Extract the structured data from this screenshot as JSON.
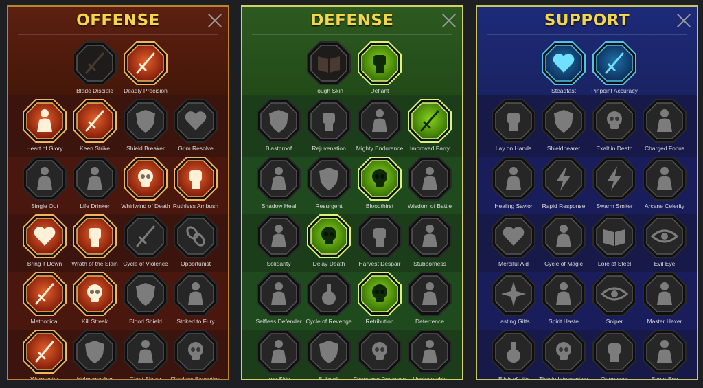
{
  "panels": [
    {
      "key": "offense",
      "title": "OFFENSE",
      "colors": {
        "active_fill": "#e2602a",
        "active_fill_dark": "#7a1708",
        "active_ring": "#f3b45a",
        "glyph": "#fff0d8"
      },
      "skills": [
        {
          "label": "Blade Disciple",
          "active": false,
          "dim": true,
          "icon": "crossed-swords-icon"
        },
        {
          "label": "Deadly Precision",
          "active": true,
          "icon": "slashing-blade-icon"
        },
        {
          "label": "Heart of Glory",
          "active": true,
          "icon": "horned-figure-icon"
        },
        {
          "label": "Keen Strike",
          "active": true,
          "icon": "arrow-strike-icon"
        },
        {
          "label": "Shield Breaker",
          "active": false,
          "icon": "broken-shield-icon"
        },
        {
          "label": "Grim Resolve",
          "active": false,
          "icon": "pierced-heart-icon"
        },
        {
          "label": "Single Out",
          "active": false,
          "icon": "single-out-icon"
        },
        {
          "label": "Life Drinker",
          "active": false,
          "icon": "fanged-mask-icon"
        },
        {
          "label": "Whirlwind of Death",
          "active": true,
          "icon": "skull-whirlwind-icon"
        },
        {
          "label": "Ruthless Ambush",
          "active": true,
          "icon": "dagger-hand-icon"
        },
        {
          "label": "Bring it Down",
          "active": true,
          "icon": "sword-heart-icon"
        },
        {
          "label": "Wrath of the Slain",
          "active": true,
          "icon": "fist-sword-icon"
        },
        {
          "label": "Cycle of Violence",
          "active": false,
          "icon": "axe-icon"
        },
        {
          "label": "Opportunist",
          "active": false,
          "icon": "chains-icon"
        },
        {
          "label": "Methodical",
          "active": true,
          "icon": "arrows-target-icon"
        },
        {
          "label": "Kill Streak",
          "active": true,
          "icon": "double-skull-icon"
        },
        {
          "label": "Blood Shield",
          "active": false,
          "icon": "blood-shield-icon"
        },
        {
          "label": "Stoked to Fury",
          "active": false,
          "icon": "raging-figure-icon"
        },
        {
          "label": "Warmaster",
          "active": true,
          "icon": "hammer-strike-icon"
        },
        {
          "label": "Helmsmasher",
          "active": false,
          "icon": "helm-icon"
        },
        {
          "label": "Giant Slayer",
          "active": false,
          "icon": "giant-icon"
        },
        {
          "label": "Flawless Execution",
          "active": false,
          "icon": "execution-skull-icon"
        }
      ]
    },
    {
      "key": "defense",
      "title": "DEFENSE",
      "colors": {
        "active_fill": "#8ad21a",
        "active_fill_dark": "#2f6a05",
        "active_ring": "#d8f57a",
        "glyph": "#0f2a06"
      },
      "skills": [
        {
          "label": "Tough Skin",
          "active": false,
          "dim": true,
          "icon": "scales-icon"
        },
        {
          "label": "Defiant",
          "active": true,
          "icon": "raised-fist-icon"
        },
        {
          "label": "Blastproof",
          "active": false,
          "icon": "chevron-shield-icon"
        },
        {
          "label": "Rejuvenation",
          "active": false,
          "icon": "hand-icon"
        },
        {
          "label": "Mighty Endurance",
          "active": false,
          "icon": "muscle-figure-icon"
        },
        {
          "label": "Improved Parry",
          "active": true,
          "icon": "crossed-blades-icon"
        },
        {
          "label": "Shadow Heal",
          "active": false,
          "icon": "shadow-figure-icon"
        },
        {
          "label": "Resurgent",
          "active": false,
          "icon": "knight-shield-icon"
        },
        {
          "label": "Bloodthirst",
          "active": true,
          "icon": "skull-heart-icon"
        },
        {
          "label": "Wisdom of Battle",
          "active": false,
          "icon": "hooded-figure-icon"
        },
        {
          "label": "Solidarity",
          "active": false,
          "icon": "group-figures-icon"
        },
        {
          "label": "Delay Death",
          "active": true,
          "icon": "hourglass-skull-icon"
        },
        {
          "label": "Harvest Despair",
          "active": false,
          "icon": "open-palm-icon"
        },
        {
          "label": "Stubborness",
          "active": false,
          "icon": "bull-head-icon"
        },
        {
          "label": "Selfless Defender",
          "active": false,
          "icon": "defender-icon"
        },
        {
          "label": "Cycle of Revenge",
          "active": false,
          "icon": "drops-icon"
        },
        {
          "label": "Retribution",
          "active": true,
          "icon": "radiant-skull-icon"
        },
        {
          "label": "Deterrence",
          "active": false,
          "icon": "deflect-icon"
        },
        {
          "label": "Iron Skin",
          "active": false,
          "icon": "armored-figure-icon"
        },
        {
          "label": "Bulwark",
          "active": false,
          "icon": "winged-shield-icon"
        },
        {
          "label": "Fearsome Presence",
          "active": false,
          "icon": "fearsome-skull-icon"
        },
        {
          "label": "Unshakeable",
          "active": false,
          "icon": "steadfast-figure-icon"
        }
      ]
    },
    {
      "key": "support",
      "title": "SUPPORT",
      "colors": {
        "active_fill": "#1f6fa8",
        "active_fill_dark": "#0c2a55",
        "active_ring": "#4fc2e8",
        "glyph": "#6fe0ff"
      },
      "skills": [
        {
          "label": "Steadfast",
          "active": true,
          "icon": "heart-sparkle-icon"
        },
        {
          "label": "Pinpoint Accuracy",
          "active": true,
          "icon": "target-arrow-icon"
        },
        {
          "label": "Lay on Hands",
          "active": false,
          "icon": "praying-hands-icon"
        },
        {
          "label": "Shieldbearer",
          "active": false,
          "icon": "shield-rings-icon"
        },
        {
          "label": "Exalt in Death",
          "active": false,
          "icon": "exalt-skull-icon"
        },
        {
          "label": "Charged Focus",
          "active": false,
          "icon": "charged-arm-icon"
        },
        {
          "label": "Healing Savior",
          "active": false,
          "icon": "healing-figure-icon"
        },
        {
          "label": "Rapid Response",
          "active": false,
          "icon": "lightning-icon"
        },
        {
          "label": "Swarm Smiter",
          "active": false,
          "icon": "swarm-bolts-icon"
        },
        {
          "label": "Arcane Celerity",
          "active": false,
          "icon": "arcane-figure-icon"
        },
        {
          "label": "Merciful Aid",
          "active": false,
          "icon": "chained-heart-icon"
        },
        {
          "label": "Cycle of Magic",
          "active": false,
          "icon": "magic-comet-icon"
        },
        {
          "label": "Lore of Steel",
          "active": false,
          "icon": "open-book-icon"
        },
        {
          "label": "Evil Eye",
          "active": false,
          "icon": "evil-eyes-icon"
        },
        {
          "label": "Lasting Gifts",
          "active": false,
          "icon": "star-burst-icon"
        },
        {
          "label": "Spirit Haste",
          "active": false,
          "icon": "winged-boot-icon"
        },
        {
          "label": "Sniper",
          "active": false,
          "icon": "eye-target-icon"
        },
        {
          "label": "Master Hexer",
          "active": false,
          "icon": "voodoo-doll-icon"
        },
        {
          "label": "Elixir of Life",
          "active": false,
          "icon": "potion-icon"
        },
        {
          "label": "Timely Intervention",
          "active": false,
          "icon": "skull-clock-icon"
        },
        {
          "label": "Oppressor",
          "active": false,
          "icon": "oppressor-fist-icon"
        },
        {
          "label": "Eagle-Eye",
          "active": false,
          "icon": "eagle-head-icon"
        }
      ]
    }
  ]
}
